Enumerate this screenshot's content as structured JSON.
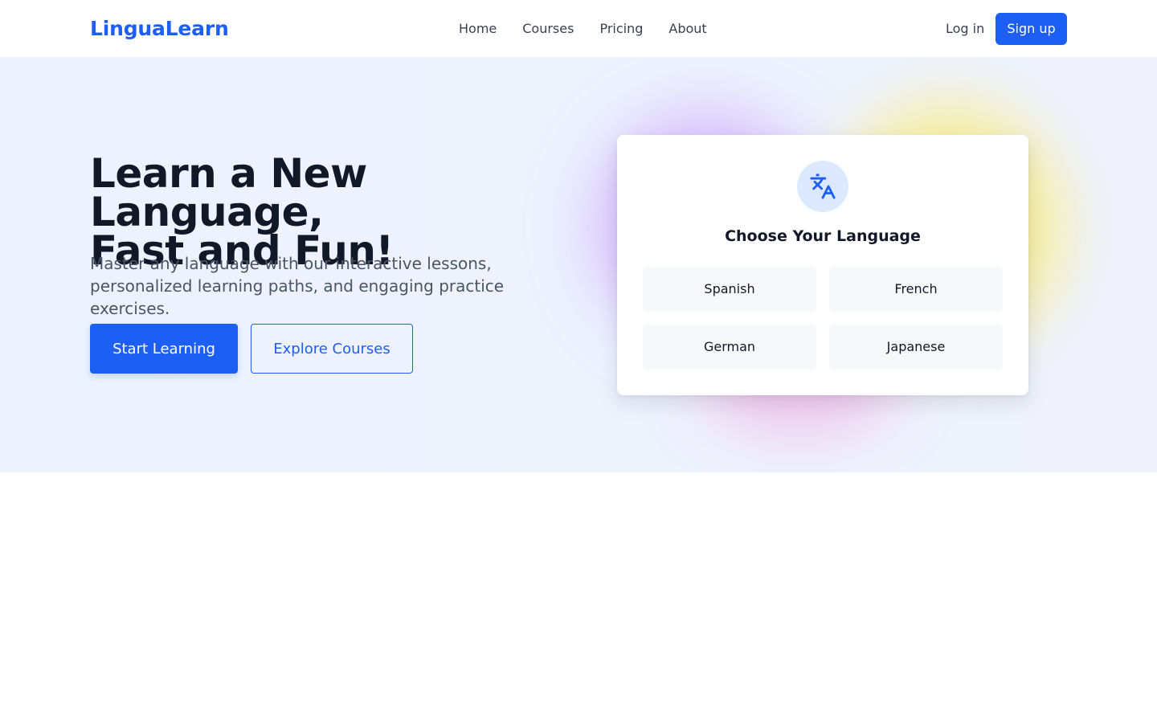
{
  "brand": {
    "name": "LinguaLearn",
    "accent_color": "#1d5ff5"
  },
  "nav": {
    "items": [
      {
        "label": "Home"
      },
      {
        "label": "Courses"
      },
      {
        "label": "Pricing"
      },
      {
        "label": "About"
      }
    ],
    "login_label": "Log in",
    "signup_label": "Sign up"
  },
  "hero": {
    "title_line1": "Learn a New Language,",
    "title_line2": "Fast and Fun!",
    "subtitle": "Master any language with our interactive lessons, personalized learning paths, and engaging practice exercises.",
    "primary_cta": "Start Learning",
    "secondary_cta": "Explore Courses"
  },
  "language_card": {
    "icon": "translate-icon",
    "title": "Choose Your Language",
    "options": [
      {
        "label": "Spanish"
      },
      {
        "label": "French"
      },
      {
        "label": "German"
      },
      {
        "label": "Japanese"
      }
    ]
  }
}
